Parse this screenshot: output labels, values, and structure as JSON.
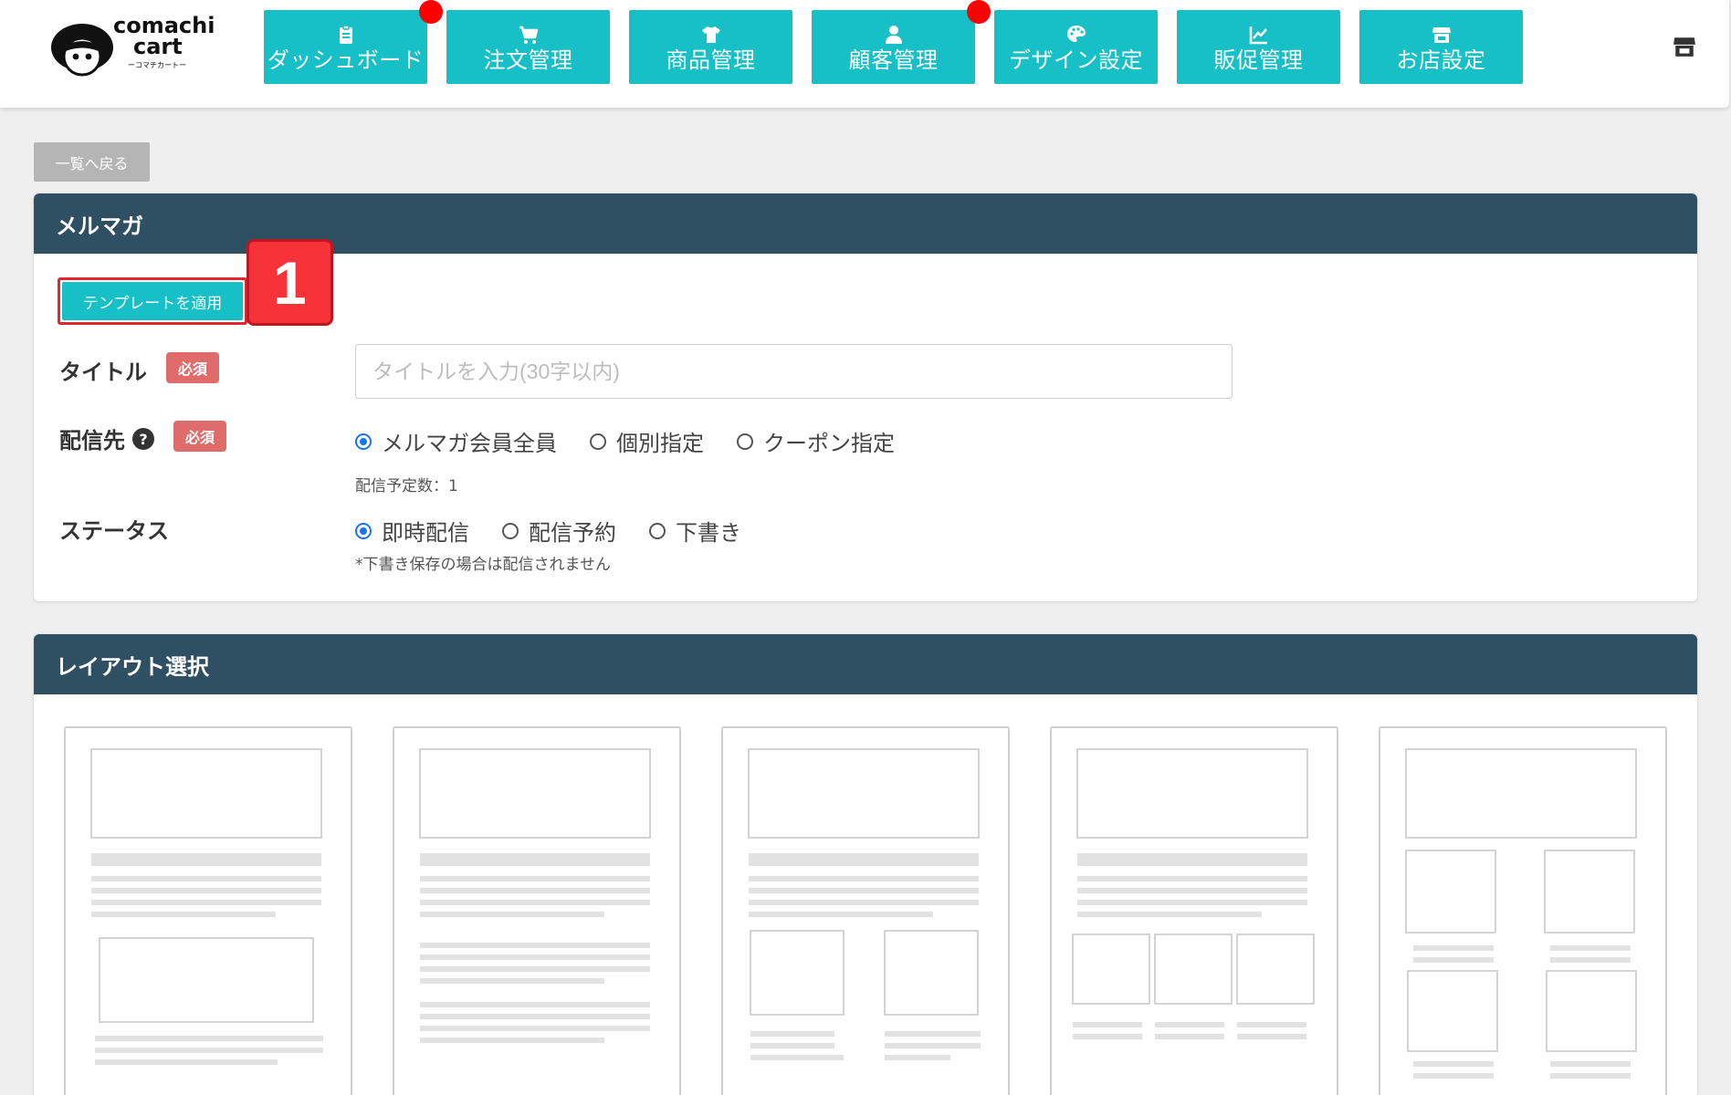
{
  "logo": {
    "line1": "comachi",
    "line2": "cart",
    "line3": "ーコマチカートー"
  },
  "nav": [
    {
      "label": "ダッシュボード",
      "icon": "clipboard-icon",
      "badge": true
    },
    {
      "label": "注文管理",
      "icon": "cart-icon",
      "badge": false
    },
    {
      "label": "商品管理",
      "icon": "tshirt-icon",
      "badge": false
    },
    {
      "label": "顧客管理",
      "icon": "user-icon",
      "badge": true
    },
    {
      "label": "デザイン設定",
      "icon": "palette-icon",
      "badge": false
    },
    {
      "label": "販促管理",
      "icon": "chart-line-icon",
      "badge": false
    },
    {
      "label": "お店設定",
      "icon": "shop-icon",
      "badge": false
    }
  ],
  "back_label": "一覧へ戻る",
  "mailmag": {
    "header": "メルマガ",
    "template_button": "テンプレートを適用",
    "step_number": "1",
    "title_label": "タイトル",
    "required": "必須",
    "title_placeholder": "タイトルを入力(30字以内)",
    "target_label": "配信先",
    "help": "?",
    "target_options": [
      "メルマガ会員全員",
      "個別指定",
      "クーポン指定"
    ],
    "target_selected": 0,
    "target_count": "配信予定数：1",
    "status_label": "ステータス",
    "status_options": [
      "即時配信",
      "配信予約",
      "下書き"
    ],
    "status_selected": 0,
    "status_note": "*下書き保存の場合は配信されません"
  },
  "layout_section": {
    "header": "レイアウト選択",
    "layouts": [
      "layout-1",
      "layout-2",
      "layout-3",
      "layout-4",
      "layout-5"
    ]
  },
  "colors": {
    "accent": "#17bfc6",
    "header_bg": "#2f4f63",
    "required": "#e06b6b",
    "badge": "#ff0000"
  }
}
